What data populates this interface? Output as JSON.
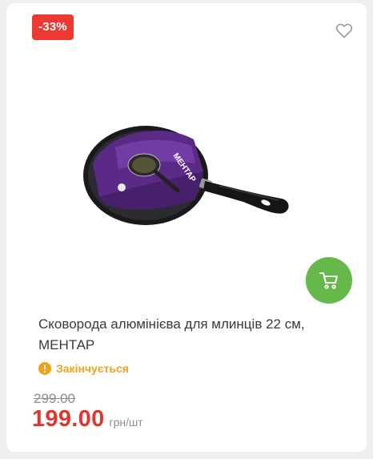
{
  "product": {
    "discount_badge": "-33%",
    "title": "Сковорода алюмінієва для млинців 22 см, МЕНТАР",
    "status": "Закінчується",
    "old_price": "299.00",
    "price": "199.00",
    "unit": "грн/шт",
    "image_icon": "frying-pan-image",
    "packaging_brand_text": "MEHTAP"
  },
  "colors": {
    "discount": "#ec3a32",
    "cart_button": "#65b84a",
    "status": "#f0a21c",
    "price": "#e0362e"
  }
}
